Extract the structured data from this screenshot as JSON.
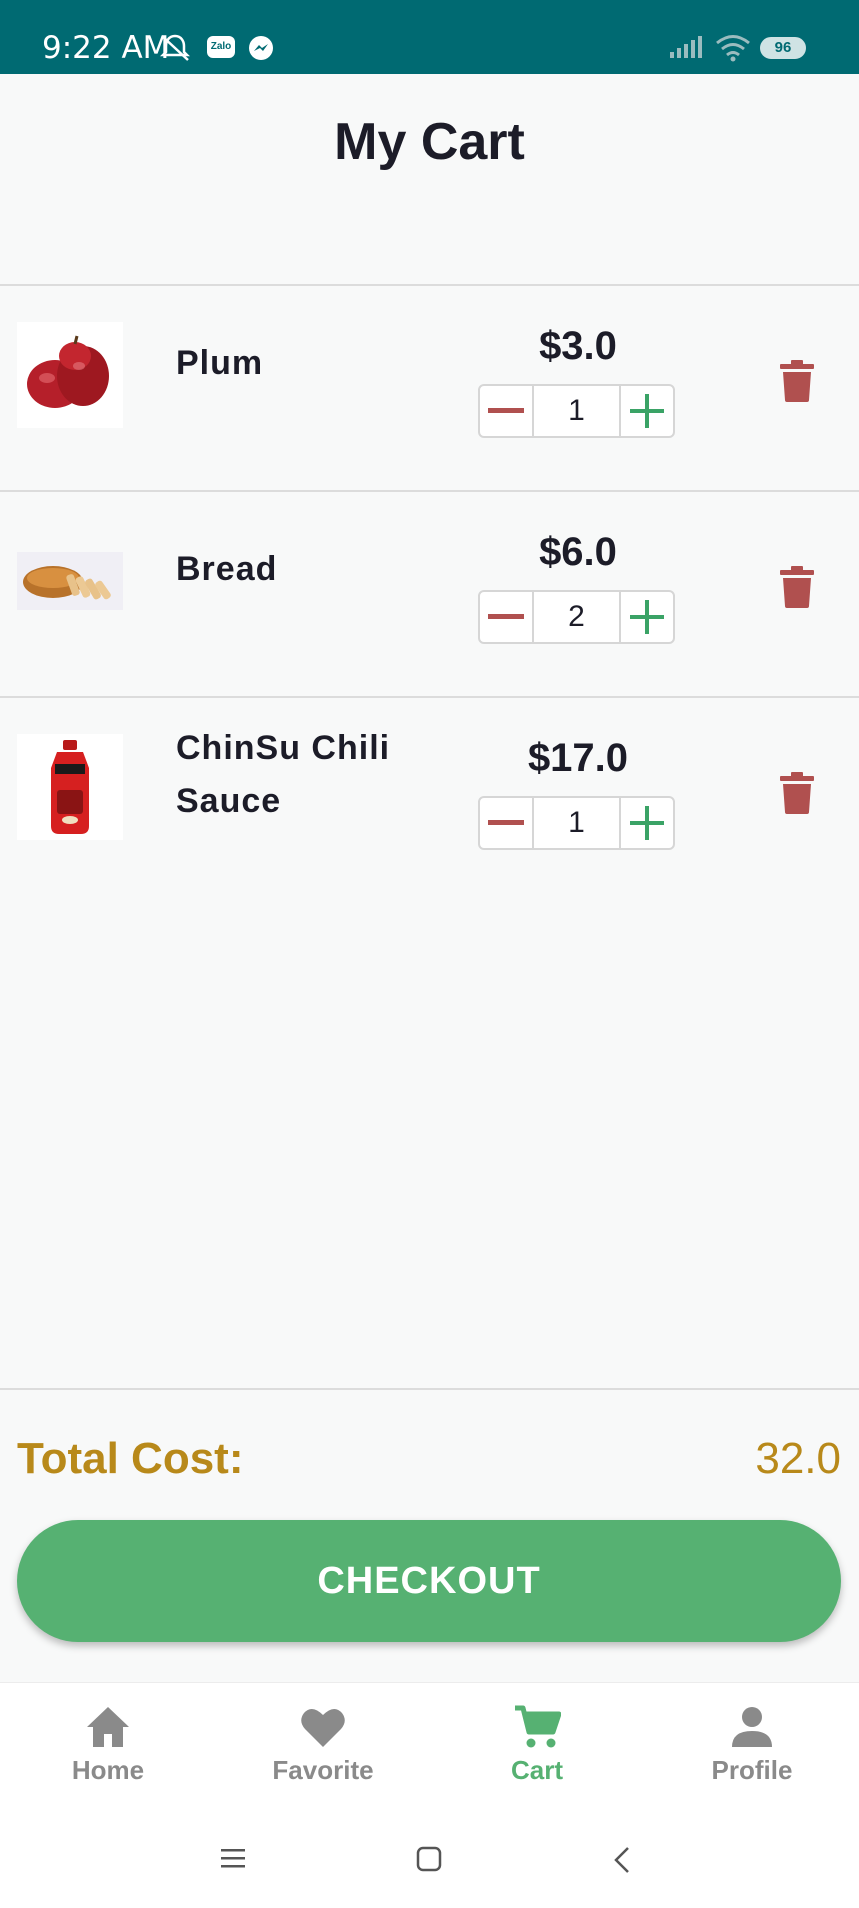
{
  "status_bar": {
    "time": "9:22 AM",
    "zalo_label": "Zalo",
    "battery": "96"
  },
  "header": {
    "title": "My Cart"
  },
  "cart_items": [
    {
      "name": "Plum",
      "price": "$3.0",
      "quantity": "1",
      "image_icon": "plum-image"
    },
    {
      "name": "Bread",
      "price": "$6.0",
      "quantity": "2",
      "image_icon": "bread-image"
    },
    {
      "name": "ChinSu Chili Sauce",
      "price": "$17.0",
      "quantity": "1",
      "image_icon": "chili-sauce-image"
    }
  ],
  "summary": {
    "total_label": "Total Cost:",
    "total_value": "32.0"
  },
  "checkout_label": "CHECKOUT",
  "bottom_nav": {
    "items": [
      {
        "label": "Home",
        "icon": "home-icon",
        "active": false
      },
      {
        "label": "Favorite",
        "icon": "heart-icon",
        "active": false
      },
      {
        "label": "Cart",
        "icon": "cart-icon",
        "active": true
      },
      {
        "label": "Profile",
        "icon": "person-icon",
        "active": false
      }
    ]
  },
  "colors": {
    "status_bar": "#006a72",
    "accent_green": "#56b172",
    "total_gold": "#b8891a",
    "delete_red": "#b0504f",
    "minus_red": "#b0504f",
    "plus_green": "#3aa366"
  }
}
